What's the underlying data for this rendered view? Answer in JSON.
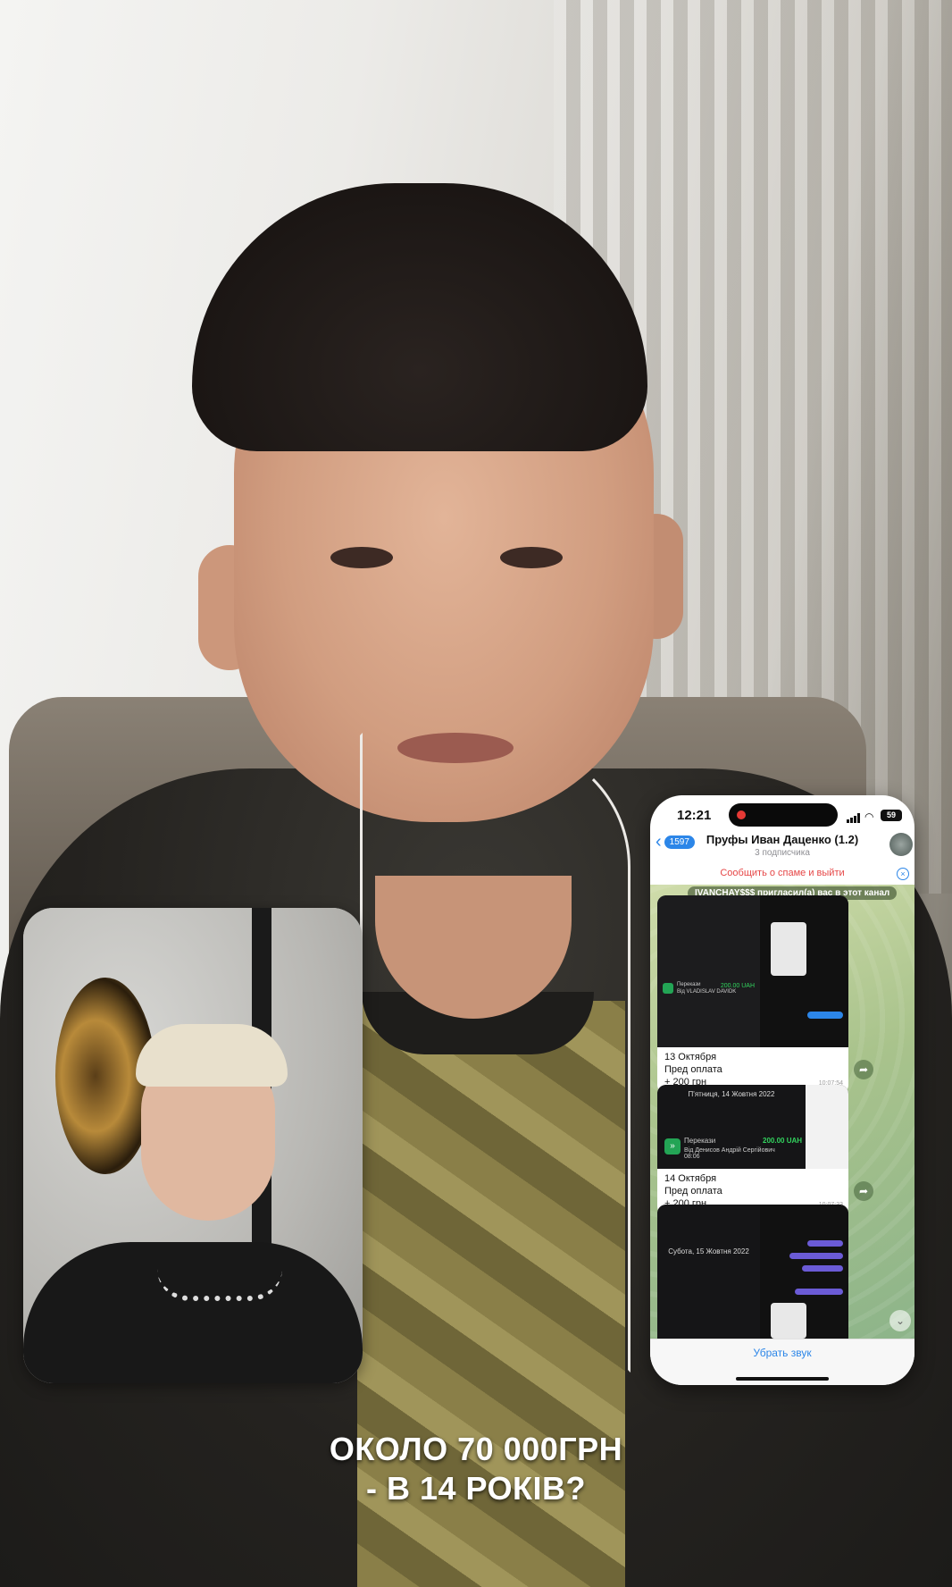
{
  "caption": {
    "line1": "ОКОЛО 70 000ГРН",
    "line2": "- В 14 РОКІВ?"
  },
  "phone": {
    "status_bar": {
      "time": "12:21",
      "battery": "59",
      "recording_indicator_color": "#e53935"
    },
    "header": {
      "back_badge": "1597",
      "channel_title": "Пруфы Иван Даценко (1.2)",
      "subscribers": "3 подписчика"
    },
    "spam_banner": {
      "text": "Сообщить о спаме и выйти",
      "close_icon": "close-icon"
    },
    "service_message": "IVANCHAY$$$ пригласил(а) вас в этот канал",
    "messages": [
      {
        "date": "13 Октября",
        "line2": "Пред оплата",
        "line3": "+ 200 грн",
        "views_time": "10:07:54",
        "media_text": "Перекази",
        "media_sender": "Від VLADISLAV DAVIDK",
        "media_amount": "200.00 UAH"
      },
      {
        "date": "14 Октября",
        "line2": "Пред оплата",
        "line3": "+ 200 грн.",
        "views_time": "10:07:33",
        "media_header": "П'ятниця, 14 Жовтня 2022",
        "media_text": "Перекази",
        "media_sender": "Від Денисов Андрій Сергійович",
        "media_time": "08:06",
        "media_amount": "200.00 UAH"
      },
      {
        "media_header": "Субота, 15 Жовтня 2022"
      }
    ],
    "mute_button": "Убрать звук"
  },
  "colors": {
    "telegram_blue": "#2c86e8",
    "spam_red": "#e64646",
    "money_green": "#32d35e"
  }
}
